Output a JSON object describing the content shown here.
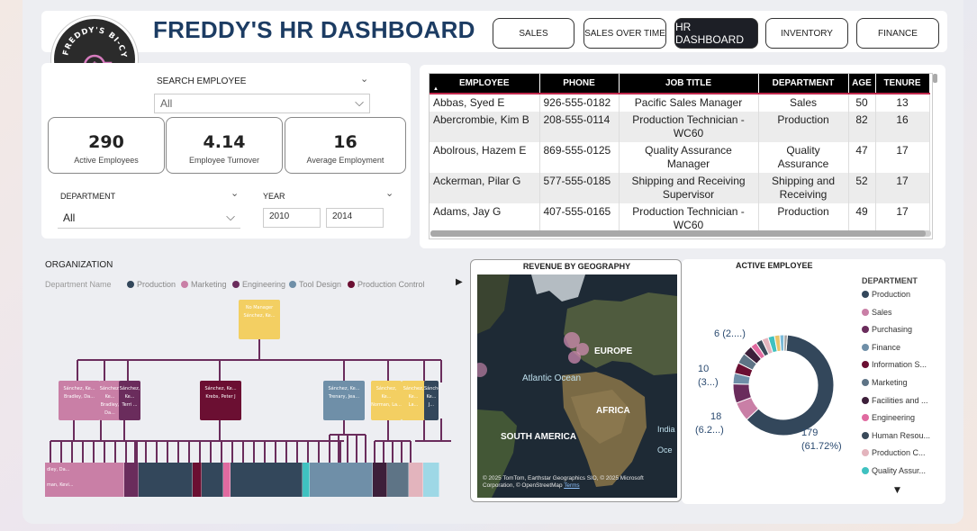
{
  "header": {
    "title": "FREDDY'S HR DASHBOARD",
    "logo_text": "FREDDY'S BI-CYCLE",
    "nav": [
      {
        "label": "SALES",
        "active": false
      },
      {
        "label": "SALES OVER TIME",
        "active": false
      },
      {
        "label": "HR DASHBOARD",
        "active": true
      },
      {
        "label": "INVENTORY",
        "active": false
      },
      {
        "label": "FINANCE",
        "active": false
      }
    ]
  },
  "filters": {
    "search_employee_label": "SEARCH EMPLOYEE",
    "search_employee_value": "All",
    "department_label": "DEPARTMENT",
    "department_value": "All",
    "year_label": "YEAR",
    "year_from": "2010",
    "year_to": "2014"
  },
  "kpis": [
    {
      "value": "290",
      "caption": "Active Employees"
    },
    {
      "value": "4.14",
      "caption": "Employee Turnover"
    },
    {
      "value": "16",
      "caption": "Average Employment"
    }
  ],
  "employee_table": {
    "columns": [
      "EMPLOYEE",
      "PHONE",
      "JOB TITLE",
      "DEPARTMENT",
      "AGE",
      "TENURE"
    ],
    "rows": [
      [
        "Abbas, Syed E",
        "926-555-0182",
        "Pacific Sales Manager",
        "Sales",
        "50",
        "13"
      ],
      [
        "Abercrombie, Kim B",
        "208-555-0114",
        "Production Technician - WC60",
        "Production",
        "82",
        "16"
      ],
      [
        "Abolrous, Hazem E",
        "869-555-0125",
        "Quality Assurance Manager",
        "Quality Assurance",
        "47",
        "17"
      ],
      [
        "Ackerman, Pilar G",
        "577-555-0185",
        "Shipping and Receiving Supervisor",
        "Shipping and Receiving",
        "52",
        "17"
      ],
      [
        "Adams, Jay G",
        "407-555-0165",
        "Production Technician - WC60",
        "Production",
        "49",
        "17"
      ]
    ]
  },
  "organization": {
    "title": "ORGANIZATION",
    "legend_label": "Department Name",
    "legend": [
      {
        "name": "Production",
        "color": "#33475b"
      },
      {
        "name": "Marketing",
        "color": "#c97fa6"
      },
      {
        "name": "Engineering",
        "color": "#6a2c5c"
      },
      {
        "name": "Tool Design",
        "color": "#6f8fa8"
      },
      {
        "name": "Production Control",
        "color": "#6b0f32"
      }
    ],
    "top_node": {
      "line1": "No Manager",
      "line2": "Sánchez, Ke..."
    },
    "mid_nodes": [
      {
        "line1": "Sánchez, Ke...",
        "line2": "Bradley, Da..."
      },
      {
        "line1": "Sánchez, Ke...",
        "line2": "Bradley, Da..."
      },
      {
        "line1": "Sánchez, Ke...",
        "line2": "Terri ..."
      },
      {
        "line1": "Sánchez, Ke...",
        "line2": "Krebs, Peter J"
      },
      {
        "line1": "Sánchez, Ke...",
        "line2": "Trenary, Jea..."
      },
      {
        "line1": "Sánchez, Ke...",
        "line2": "Norman, La..."
      },
      {
        "line1": "Sánchez, Ke...",
        "line2": "La..."
      },
      {
        "line1": "Sánchez, Ke...",
        "line2": "J..."
      }
    ],
    "bottom_sample": [
      "dley, Da...",
      "man, Kevi...",
      "rri ...",
      "HcV ...",
      "Gar..."
    ]
  },
  "geo": {
    "title": "REVENUE BY GEOGRAPHY",
    "labels": [
      "EUROPE",
      "Atlantic Ocean",
      "AFRICA",
      "SOUTH AMERICA",
      "India",
      "Oce"
    ],
    "attribution": "© 2025 TomTom, Earthstar Geographics SIO, © 2025 Microsoft Corporation, © OpenStreetMap",
    "terms": "Terms"
  },
  "active_employee": {
    "title": "ACTIVE EMPLOYEE",
    "legend_title": "DEPARTMENT",
    "legend": [
      {
        "name": "Production",
        "color": "#33475b"
      },
      {
        "name": "Sales",
        "color": "#c97fa6"
      },
      {
        "name": "Purchasing",
        "color": "#6a2c5c"
      },
      {
        "name": "Finance",
        "color": "#6f8fa8"
      },
      {
        "name": "Information S...",
        "color": "#6b0f32"
      },
      {
        "name": "Marketing",
        "color": "#5e7486"
      },
      {
        "name": "Facilities and ...",
        "color": "#3d1f3a"
      },
      {
        "name": "Engineering",
        "color": "#e06aa0"
      },
      {
        "name": "Human Resou...",
        "color": "#3a4a5a"
      },
      {
        "name": "Production C...",
        "color": "#e3b4bd"
      },
      {
        "name": "Quality Assur...",
        "color": "#3fc1c0"
      }
    ],
    "labels": [
      {
        "value": "179",
        "pct": "(61.72%)"
      },
      {
        "value": "18",
        "pct": "(6.2...)"
      },
      {
        "value": "10",
        "pct": "(3...)"
      },
      {
        "value": "6",
        "pct": "(2....)"
      }
    ],
    "chart_data": {
      "type": "pie",
      "values": [
        179,
        18,
        18,
        10,
        10,
        10,
        9,
        6,
        6,
        6,
        6,
        5,
        4,
        3
      ],
      "colors": [
        "#33475b",
        "#c97fa6",
        "#6a2c5c",
        "#6f8fa8",
        "#6b0f32",
        "#5e7486",
        "#3d1f3a",
        "#e06aa0",
        "#3a4a5a",
        "#e3b4bd",
        "#3fc1c0",
        "#e8c46a",
        "#7bbad8",
        "#a0a0a0"
      ]
    }
  }
}
